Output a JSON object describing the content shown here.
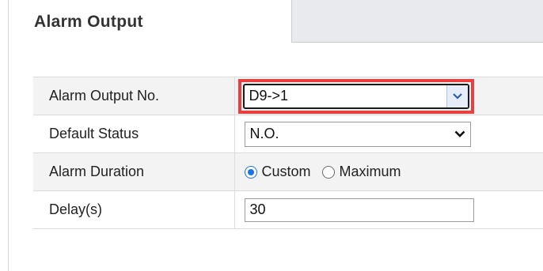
{
  "tabs": {
    "active_label": "Alarm Output"
  },
  "form": {
    "alarm_output_no": {
      "label": "Alarm Output No.",
      "selected": "D9->1"
    },
    "default_status": {
      "label": "Default Status",
      "selected": "N.O."
    },
    "alarm_duration": {
      "label": "Alarm Duration",
      "options": [
        "Custom",
        "Maximum"
      ],
      "selected_option": "Custom"
    },
    "delay": {
      "label": "Delay(s)",
      "value": "30"
    }
  },
  "colors": {
    "highlight": "#e8403f",
    "radio_accent": "#1a73e8",
    "row_shade": "#f3f3f3",
    "inactive_tab": "#e9eaed"
  },
  "icons": {
    "select_arrow_1": "chevron-down-icon",
    "select_arrow_2": "chevron-down-icon"
  }
}
